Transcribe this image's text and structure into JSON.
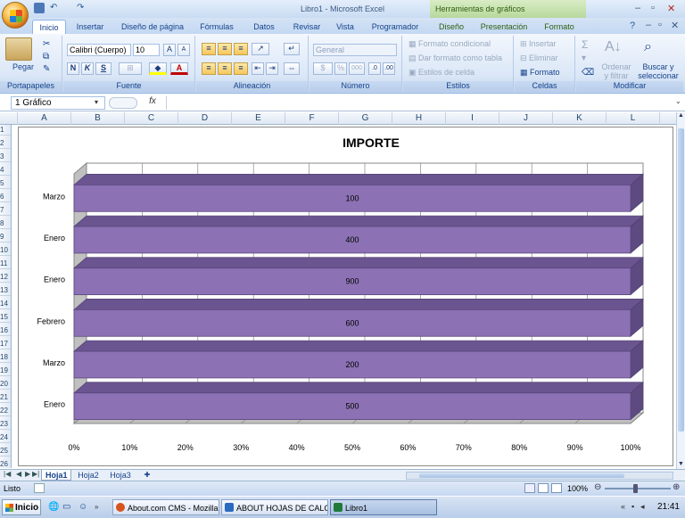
{
  "window": {
    "title": "Libro1 - Microsoft Excel",
    "context_tools": "Herramientas de gráficos"
  },
  "ribbon": {
    "tabs": [
      {
        "label": "Inicio",
        "active": true
      },
      {
        "label": "Insertar"
      },
      {
        "label": "Diseño de página"
      },
      {
        "label": "Fórmulas"
      },
      {
        "label": "Datos"
      },
      {
        "label": "Revisar"
      },
      {
        "label": "Vista"
      },
      {
        "label": "Programador"
      },
      {
        "label": "Diseño",
        "contextual": true
      },
      {
        "label": "Presentación",
        "contextual": true
      },
      {
        "label": "Formato",
        "contextual": true
      }
    ],
    "groups": {
      "portapapeles": {
        "label": "Portapapeles",
        "paste": "Pegar"
      },
      "fuente": {
        "label": "Fuente",
        "font": "Calibri (Cuerpo)",
        "size": "10",
        "bold": "N",
        "italic": "K",
        "underline": "S"
      },
      "alineacion": {
        "label": "Alineación"
      },
      "numero": {
        "label": "Número",
        "format": "General",
        "percent": "%",
        "thousands": "000"
      },
      "estilos": {
        "label": "Estilos",
        "cond": "Formato condicional",
        "table": "Dar formato como tabla",
        "cell": "Estilos de celda"
      },
      "celdas": {
        "label": "Celdas",
        "insert": "Insertar",
        "delete": "Eliminar",
        "format": "Formato"
      },
      "modificar": {
        "label": "Modificar",
        "sort": "Ordenar y filtrar",
        "find": "Buscar y seleccionar",
        "sigma": "Σ"
      }
    }
  },
  "formula_bar": {
    "name_box": "1 Gráfico",
    "fx": "fx",
    "content": ""
  },
  "columns": [
    "A",
    "B",
    "C",
    "D",
    "E",
    "F",
    "G",
    "H",
    "I",
    "J",
    "K",
    "L"
  ],
  "rows": [
    "1",
    "2",
    "3",
    "4",
    "5",
    "6",
    "7",
    "8",
    "9",
    "10",
    "11",
    "12",
    "13",
    "14",
    "15",
    "16",
    "17",
    "18",
    "19",
    "20",
    "21",
    "22",
    "23",
    "24",
    "25",
    "26"
  ],
  "sheets": {
    "tabs": [
      "Hoja1",
      "Hoja2",
      "Hoja3"
    ],
    "active": "Hoja1"
  },
  "status": {
    "mode": "Listo",
    "zoom": "100%"
  },
  "taskbar": {
    "start": "Inicio",
    "items": [
      {
        "label": "About.com CMS - Mozilla ...",
        "color": "#d9531e"
      },
      {
        "label": "ABOUT HOJAS DE CALC...",
        "color": "#2b6bbf"
      },
      {
        "label": "Libro1",
        "color": "#1f7a3a",
        "active": true
      }
    ],
    "clock": "21:41"
  },
  "chart_data": {
    "type": "bar",
    "orientation": "horizontal",
    "stacked_percent": true,
    "three_d": true,
    "title": "IMPORTE",
    "categories": [
      "Enero",
      "Marzo",
      "Febrero",
      "Enero",
      "Enero",
      "Marzo"
    ],
    "values": [
      500,
      200,
      600,
      900,
      400,
      100
    ],
    "x_ticks": [
      "0%",
      "10%",
      "20%",
      "30%",
      "40%",
      "50%",
      "60%",
      "70%",
      "80%",
      "90%",
      "100%"
    ],
    "xlim": [
      0,
      100
    ],
    "grid": true,
    "legend": "none",
    "color": "#8c72b4"
  }
}
